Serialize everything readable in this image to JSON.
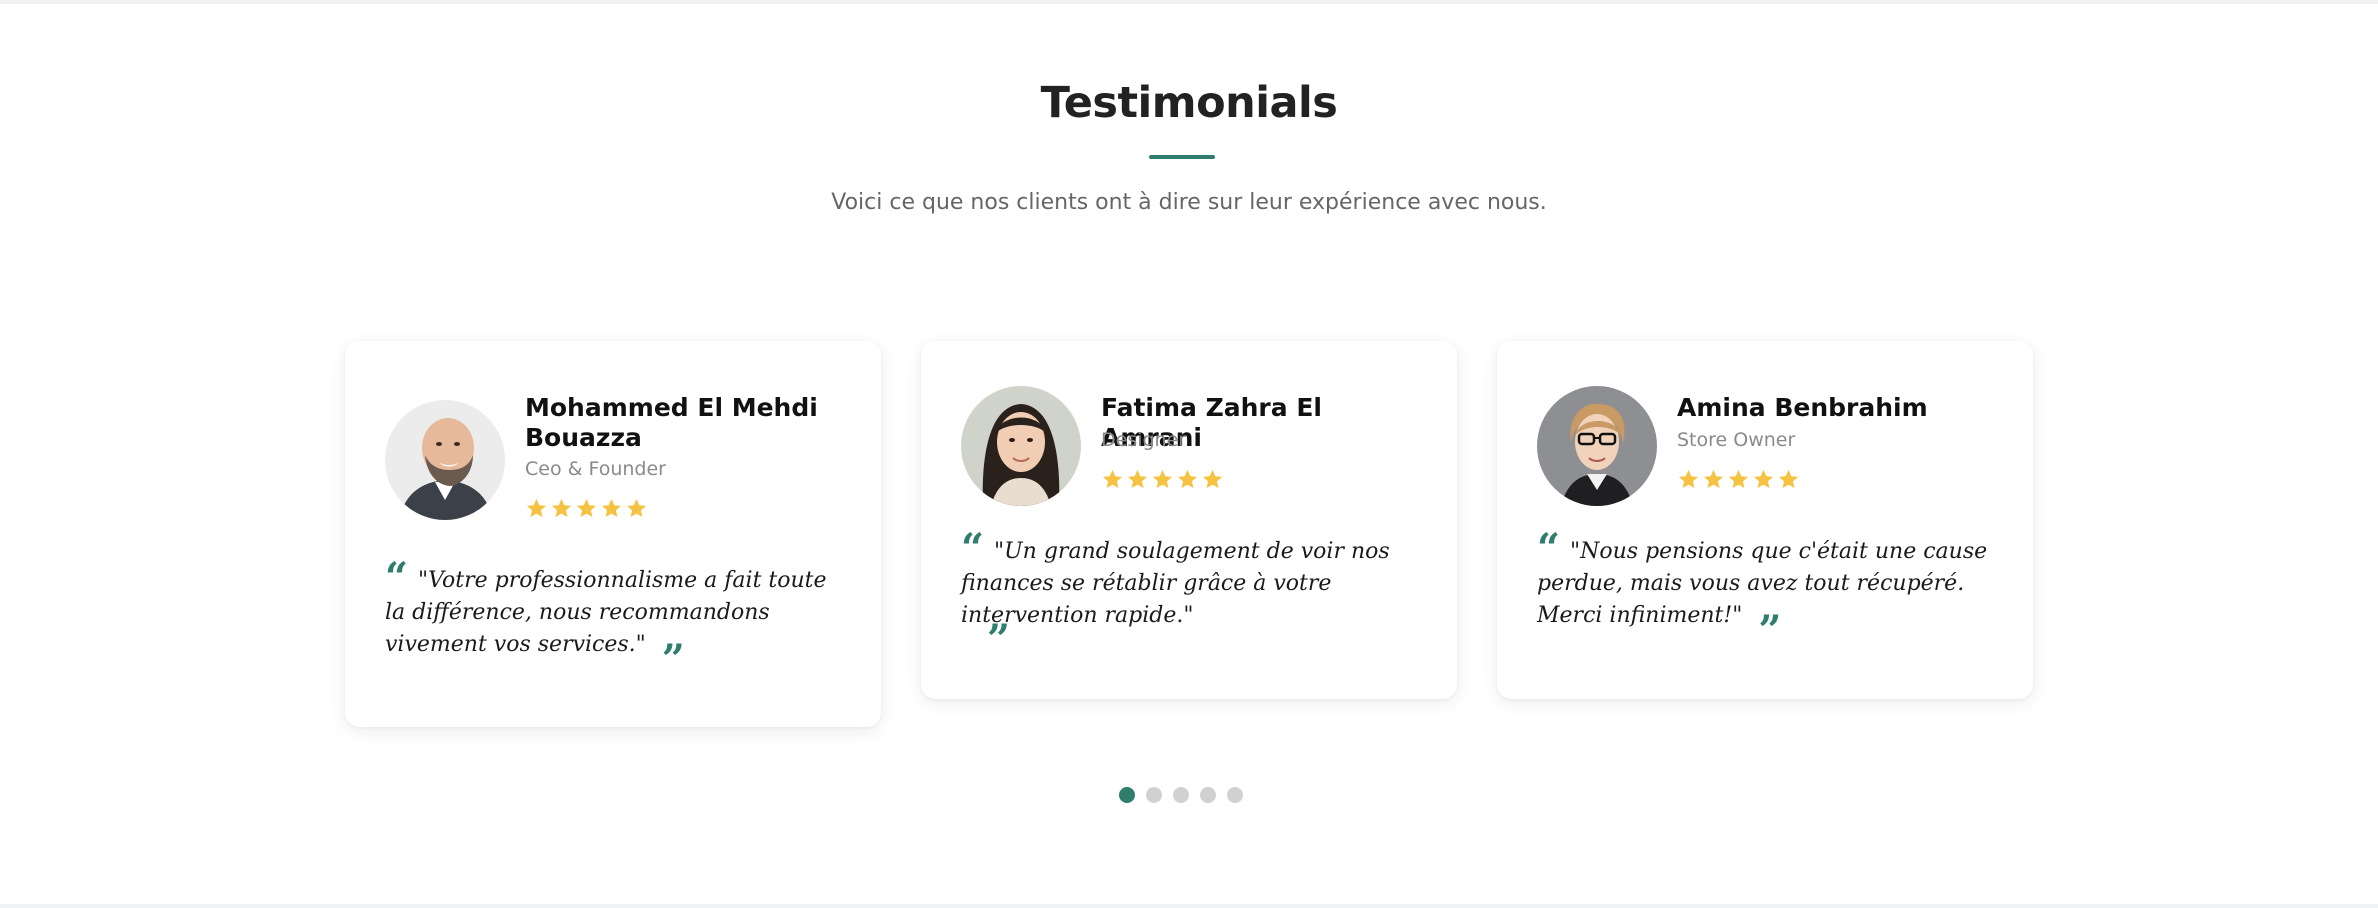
{
  "section": {
    "title": "Testimonials",
    "subtitle": "Voici ce que nos clients ont à dire sur leur expérience avec nous."
  },
  "testimonials": [
    {
      "name": "Mohammed El Mehdi Bouazza",
      "role": "Ceo & Founder",
      "rating": 5,
      "quote": "\"Votre professionnalisme a fait toute la différence, nous recommandons vivement vos services.\""
    },
    {
      "name": "Fatima Zahra El Amrani",
      "role": "Designer",
      "rating": 5,
      "quote": "\"Un grand soulagement de voir nos finances se rétablir grâce à votre intervention rapide.\""
    },
    {
      "name": "Amina Benbrahim",
      "role": "Store Owner",
      "rating": 5,
      "quote": "\"Nous pensions que c'était une cause perdue, mais vous avez tout récupéré. Merci infiniment!\""
    }
  ],
  "pagination": {
    "total": 5,
    "active": 1
  },
  "colors": {
    "accent": "#2f7d6d",
    "star": "#f5c242",
    "dot_inactive": "#d1d1d1"
  },
  "icons": {
    "open_quote": "quote-open-icon",
    "close_quote": "quote-close-icon",
    "star": "star-icon"
  }
}
